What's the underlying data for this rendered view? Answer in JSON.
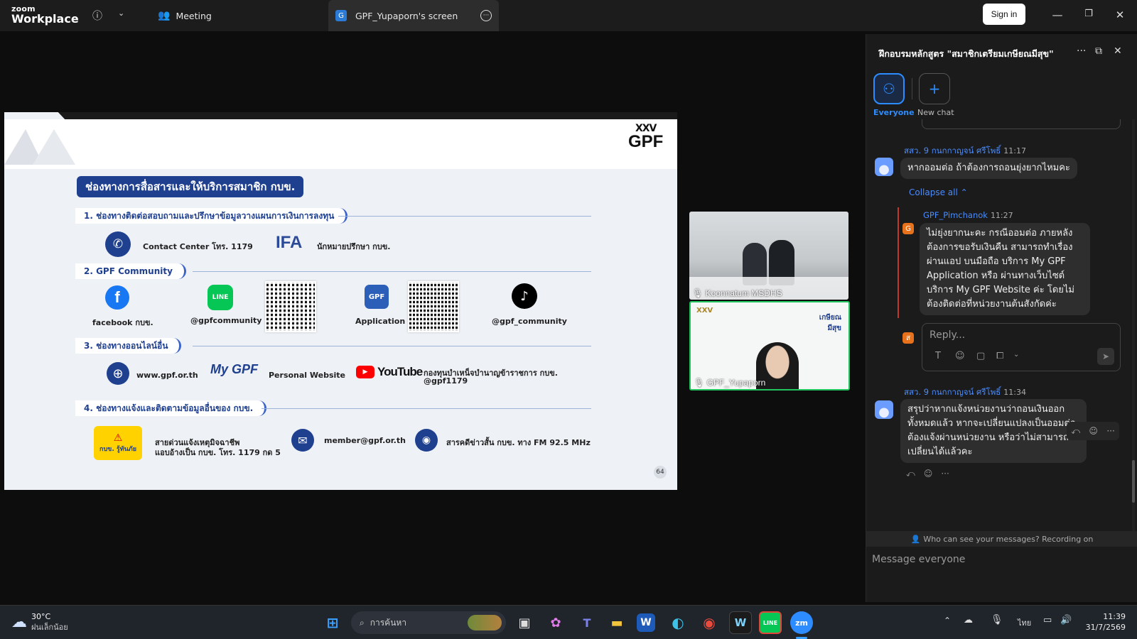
{
  "app": {
    "logo_line1": "zoom",
    "logo_line2": "Workplace"
  },
  "titlebar": {
    "meeting_tab": "Meeting",
    "share_tab": "GPF_Yupaporn's screen",
    "share_tab_initial": "G",
    "signin": "Sign in"
  },
  "slide": {
    "title": "ช่องทางการสื่อสารและให้บริการสมาชิก กบข.",
    "logo_text": "GPF",
    "page_number": "64",
    "sections": [
      "1. ช่องทางติดต่อสอบถามและปรึกษาข้อมูลวางแผนการเงินการลงทุน",
      "2. GPF Community",
      "3. ช่องทางออนไลน์อื่น",
      "4. ช่องทางแจ้งและติดตามข้อมูลอื่นของ กบข."
    ],
    "contact_center": "Contact Center โทร. 1179",
    "ifa_logo": "IFA",
    "ifa_text": "นักหมายปรึกษา กบข.",
    "facebook": "facebook กบข.",
    "line_label": "@gpfcommunity",
    "line_icon": "LINE",
    "application": "Application",
    "app_icon": "GPF",
    "tiktok": "@gpf_community",
    "website": "www.gpf.or.th",
    "mygpf": "My GPF",
    "personal_website": "Personal Website",
    "youtube": "YouTube",
    "youtube_text_1": "กองทุนบำเหน็จบำนาญข้าราชการ กบข.",
    "youtube_text_2": "@gpf1179",
    "hotline_badge": "กบข. รู้ทันภัย",
    "hotline_1": "สายด่วนแจ้งเหตุมิจฉาชีพ",
    "hotline_2": "แอบอ้างเป็น กบข. โทร. 1179 กด 5",
    "email": "member@gpf.or.th",
    "radio": "สารคดีข่าวสั้น กบข. ทาง FM 92.5 MHz"
  },
  "videos": [
    {
      "name": "Koonnatum MSDHS"
    },
    {
      "name": "GPF_Yupaporn",
      "slide_brand": "เกษียณ มีสุข"
    }
  ],
  "chat": {
    "title": "ฝึกอบรมหลักสูตร \"สมาชิกเตรียมเกษียณมีสุข\"",
    "everyone": "Everyone",
    "new_chat": "New chat",
    "messages": [
      {
        "sender": "สสว. 9 กนกกาญจน์ ศรีโพธิ์",
        "time": "11:17",
        "text": "หากออมต่อ ถ้าต้องการถอนยุ่งยากไหมคะ"
      },
      {
        "sender": "GPF_Pimchanok",
        "time": "11:27",
        "text": "ไม่ยุ่งยากนะคะ กรณีออมต่อ ภายหลังต้องการขอรับเงินคืน สามารถทำเรื่องผ่านแอป บนมือถือ บริการ My GPF Application หรือ ผ่านทางเว็บไซต์ บริการ  My GPF Website ค่ะ โดยไม่ต้องติดต่อที่หน่วยงานต้นสังกัดค่ะ",
        "avatar_letter": "G"
      },
      {
        "sender": "สสว. 9 กนกกาญจน์ ศรีโพธิ์",
        "time": "11:34",
        "text": "สรุปว่าหากแจ้งหน่วยงานว่าถอนเงินออกทั้งหมดแล้ว หากจะเปลี่ยนแปลงเป็นออมต่อ ต้องแจ้งผ่านหน่วยงาน  หรือว่าไม่สามารถเปลี่ยนได้แล้วคะ"
      }
    ],
    "collapse_all": "Collapse all",
    "reply_placeholder": "Reply...",
    "reply_avatar": "ส",
    "privacy": "Who can see your messages? Recording on",
    "input_placeholder": "Message everyone"
  },
  "taskbar": {
    "weather_temp": "30°C",
    "weather_desc": "ฝนเล็กน้อย",
    "search_placeholder": "การค้นหา",
    "lang": "ไทย",
    "time": "11:39",
    "date": "31/7/2569",
    "apps": [
      "W",
      "LINE",
      "zm"
    ]
  }
}
